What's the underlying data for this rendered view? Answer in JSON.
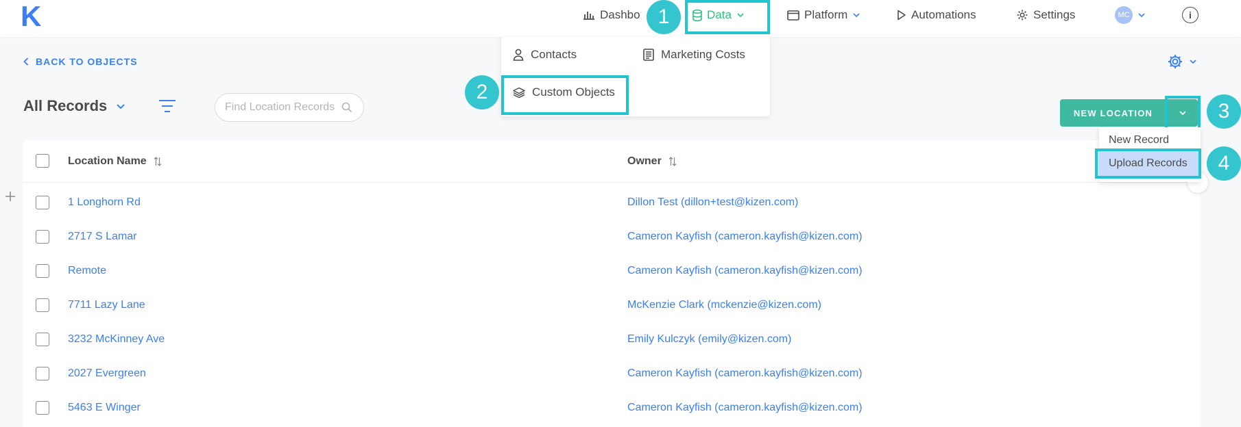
{
  "app": {
    "logo": "K"
  },
  "nav": {
    "dashboards": "Dashbo",
    "data": "Data",
    "platform": "Platform",
    "automations": "Automations",
    "settings": "Settings",
    "avatar_initials": "MC",
    "info": "i"
  },
  "data_menu": {
    "contacts": "Contacts",
    "marketing_costs": "Marketing Costs",
    "custom_objects": "Custom Objects"
  },
  "page": {
    "back_label": "BACK TO OBJECTS",
    "view_label": "All Records",
    "search_placeholder": "Find Location Records",
    "new_location_label": "NEW LOCATION"
  },
  "location_menu": {
    "new_record": "New Record",
    "upload_records": "Upload Records"
  },
  "badges": [
    "1",
    "2",
    "3",
    "4"
  ],
  "table": {
    "columns": [
      "Location Name",
      "Owner"
    ],
    "rows": [
      {
        "name": "1 Longhorn Rd",
        "owner": "Dillon Test (dillon+test@kizen.com)"
      },
      {
        "name": "2717 S Lamar",
        "owner": "Cameron Kayfish (cameron.kayfish@kizen.com)"
      },
      {
        "name": "Remote",
        "owner": "Cameron Kayfish (cameron.kayfish@kizen.com)"
      },
      {
        "name": "7711 Lazy Lane",
        "owner": "McKenzie Clark (mckenzie@kizen.com)"
      },
      {
        "name": "3232 McKinney Ave",
        "owner": "Emily Kulczyk (emily@kizen.com)"
      },
      {
        "name": "2027 Evergreen",
        "owner": "Cameron Kayfish (cameron.kayfish@kizen.com)"
      },
      {
        "name": "5463 E Winger",
        "owner": "Cameron Kayfish (cameron.kayfish@kizen.com)"
      }
    ]
  },
  "colors": {
    "accent_blue": "#3a7ff3",
    "accent_green": "#3fb99f",
    "highlight_cyan": "#21c4cf",
    "badge_cyan": "#35c5cf",
    "active_nav_green": "#2ec27e"
  },
  "icons": [
    "bar-chart-icon",
    "database-icon",
    "window-icon",
    "play-icon",
    "gear-icon",
    "chevron-down-icon",
    "user-icon",
    "document-list-icon",
    "layers-icon",
    "chevron-left-icon",
    "filter-icon",
    "search-icon",
    "sort-icon",
    "plus-icon",
    "info-icon"
  ]
}
